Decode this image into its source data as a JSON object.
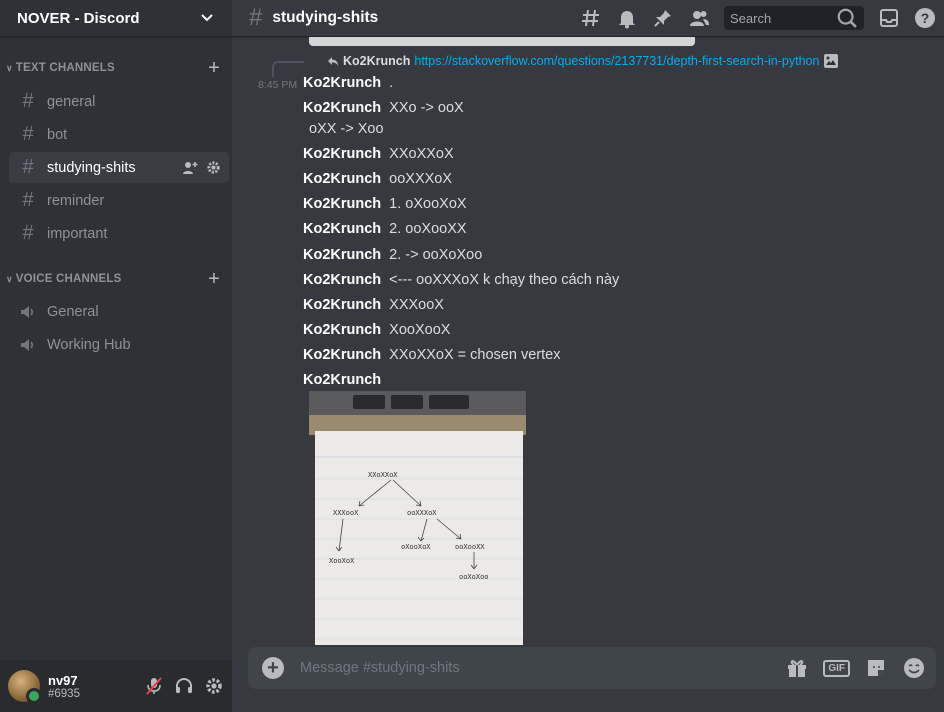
{
  "server": {
    "name": "NOVER - Discord"
  },
  "text_category": "TEXT CHANNELS",
  "voice_category": "VOICE CHANNELS",
  "text_channels": [
    {
      "name": "general"
    },
    {
      "name": "bot"
    },
    {
      "name": "studying-shits"
    },
    {
      "name": "reminder"
    },
    {
      "name": "important"
    }
  ],
  "voice_channels": [
    {
      "name": "General"
    },
    {
      "name": "Working Hub"
    }
  ],
  "user": {
    "name": "nv97",
    "discriminator": "#6935"
  },
  "channel": {
    "title": "studying-shits"
  },
  "search": {
    "placeholder": "Search"
  },
  "reply": {
    "author": "Ko2Krunch",
    "link": "https://stackoverflow.com/questions/2137731/depth-first-search-in-python"
  },
  "timestamp": "8:45 PM",
  "messages": [
    {
      "author": "Ko2Krunch",
      "text": "."
    },
    {
      "author": "Ko2Krunch",
      "text": "XXo -> ooX",
      "continuation": "oXX -> Xoo"
    },
    {
      "author": "Ko2Krunch",
      "text": "XXoXXoX"
    },
    {
      "author": "Ko2Krunch",
      "text": "ooXXXoX"
    },
    {
      "author": "Ko2Krunch",
      "text": "1. oXooXoX"
    },
    {
      "author": "Ko2Krunch",
      "text": "2. ooXooXX"
    },
    {
      "author": "Ko2Krunch",
      "text": "2. -> ooXoXoo"
    },
    {
      "author": "Ko2Krunch",
      "text": "<--- ooXXXoX k chạy theo cách này"
    },
    {
      "author": "Ko2Krunch",
      "text": "XXXooX"
    },
    {
      "author": "Ko2Krunch",
      "text": "XooXooX"
    },
    {
      "author": "Ko2Krunch",
      "text": "XXoXXoX = chosen vertex"
    },
    {
      "author": "Ko2Krunch",
      "text": ""
    }
  ],
  "sketch": {
    "root": "XXoXXoX",
    "left": "XXXooX",
    "middle": "ooXXXoX",
    "left_child": "XooXoX",
    "mid_child": "oXooXoX",
    "right_child": "ooXooXX",
    "right_grandchild": "ooXoXoo"
  },
  "composer": {
    "placeholder": "Message #studying-shits"
  },
  "colors": {
    "accent": "#5865f2",
    "link": "#00b0f4",
    "online": "#3ba55d"
  }
}
